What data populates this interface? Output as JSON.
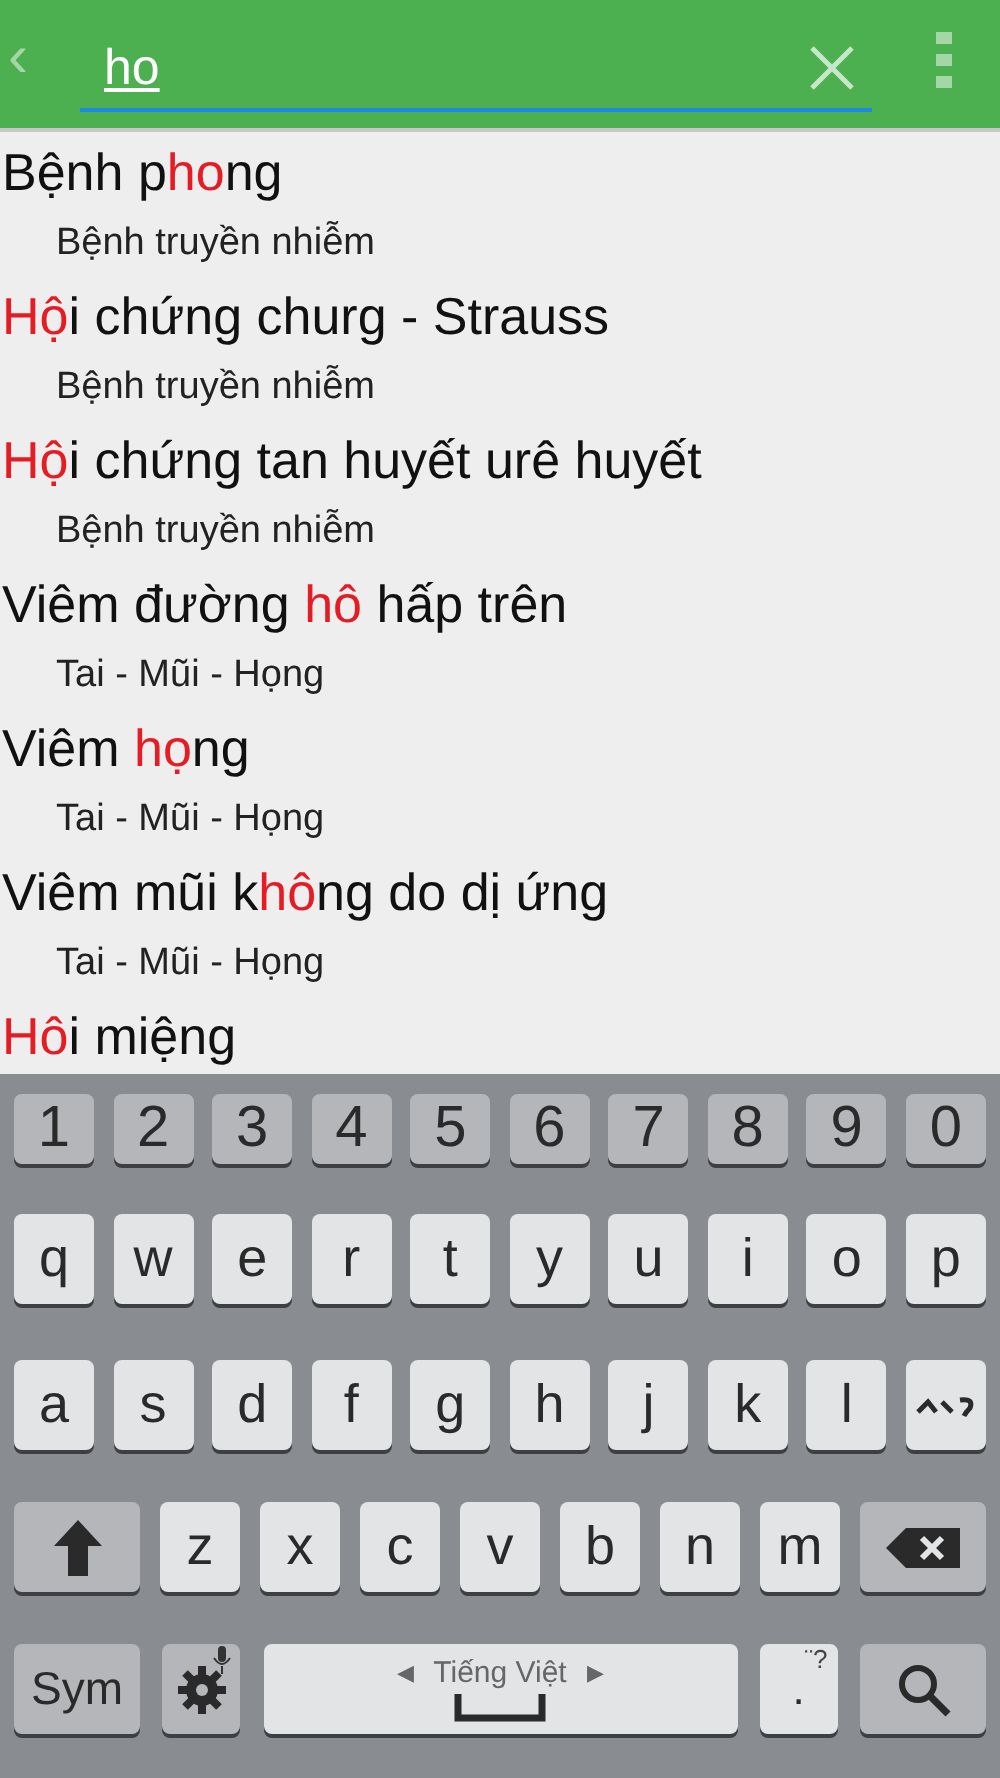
{
  "search": {
    "value": "ho",
    "back": "‹"
  },
  "results": [
    {
      "title": [
        {
          "text": "Bệnh p",
          "match": false
        },
        {
          "text": "ho",
          "match": true
        },
        {
          "text": "ng",
          "match": false
        }
      ],
      "category": "Bệnh truyền nhiễm"
    },
    {
      "title": [
        {
          "text": "Hộ",
          "match": true
        },
        {
          "text": "i chứng churg - Strauss",
          "match": false
        }
      ],
      "category": "Bệnh truyền nhiễm"
    },
    {
      "title": [
        {
          "text": "Hộ",
          "match": true
        },
        {
          "text": "i chứng tan huyết urê huyết",
          "match": false
        }
      ],
      "category": "Bệnh truyền nhiễm"
    },
    {
      "title": [
        {
          "text": "Viêm đường ",
          "match": false
        },
        {
          "text": "hô",
          "match": true
        },
        {
          "text": " hấp trên",
          "match": false
        }
      ],
      "category": "Tai - Mũi - Họng"
    },
    {
      "title": [
        {
          "text": "Viêm ",
          "match": false
        },
        {
          "text": "họ",
          "match": true
        },
        {
          "text": "ng",
          "match": false
        }
      ],
      "category": "Tai - Mũi - Họng"
    },
    {
      "title": [
        {
          "text": "Viêm mũi k",
          "match": false
        },
        {
          "text": "hô",
          "match": true
        },
        {
          "text": "ng do dị ứng",
          "match": false
        }
      ],
      "category": "Tai - Mũi - Họng"
    },
    {
      "title": [
        {
          "text": "Hô",
          "match": true
        },
        {
          "text": "i miệng",
          "match": false
        }
      ]
    }
  ],
  "keyboard": {
    "rows": [
      [
        {
          "kind": "digit",
          "label": "1"
        },
        {
          "kind": "digit",
          "label": "2"
        },
        {
          "kind": "digit",
          "label": "3"
        },
        {
          "kind": "digit",
          "label": "4"
        },
        {
          "kind": "digit",
          "label": "5"
        },
        {
          "kind": "digit",
          "label": "6"
        },
        {
          "kind": "digit",
          "label": "7"
        },
        {
          "kind": "digit",
          "label": "8"
        },
        {
          "kind": "digit",
          "label": "9"
        },
        {
          "kind": "digit",
          "label": "0"
        }
      ],
      [
        {
          "kind": "char",
          "label": "q"
        },
        {
          "kind": "char",
          "label": "w"
        },
        {
          "kind": "char",
          "label": "e"
        },
        {
          "kind": "char",
          "label": "r"
        },
        {
          "kind": "char",
          "label": "t"
        },
        {
          "kind": "char",
          "label": "y"
        },
        {
          "kind": "char",
          "label": "u"
        },
        {
          "kind": "char",
          "label": "i"
        },
        {
          "kind": "char",
          "label": "o"
        },
        {
          "kind": "char",
          "label": "p"
        }
      ],
      [
        {
          "kind": "char",
          "label": "a"
        },
        {
          "kind": "char",
          "label": "s"
        },
        {
          "kind": "char",
          "label": "d"
        },
        {
          "kind": "char",
          "label": "f"
        },
        {
          "kind": "char",
          "label": "g"
        },
        {
          "kind": "char",
          "label": "h"
        },
        {
          "kind": "char",
          "label": "j"
        },
        {
          "kind": "char",
          "label": "k"
        },
        {
          "kind": "char",
          "label": "l"
        },
        {
          "kind": "tones"
        }
      ],
      [
        {
          "kind": "shift"
        },
        {
          "kind": "char",
          "label": "z"
        },
        {
          "kind": "char",
          "label": "x"
        },
        {
          "kind": "char",
          "label": "c"
        },
        {
          "kind": "char",
          "label": "v"
        },
        {
          "kind": "char",
          "label": "b"
        },
        {
          "kind": "char",
          "label": "n"
        },
        {
          "kind": "char",
          "label": "m"
        },
        {
          "kind": "backspace"
        }
      ]
    ],
    "bottom_row": {
      "symbols": "Sym",
      "language": "Tiếng Việt",
      "language_prev": "◀",
      "language_next": "▶",
      "period": ".",
      "period_hint": "¨?"
    }
  }
}
